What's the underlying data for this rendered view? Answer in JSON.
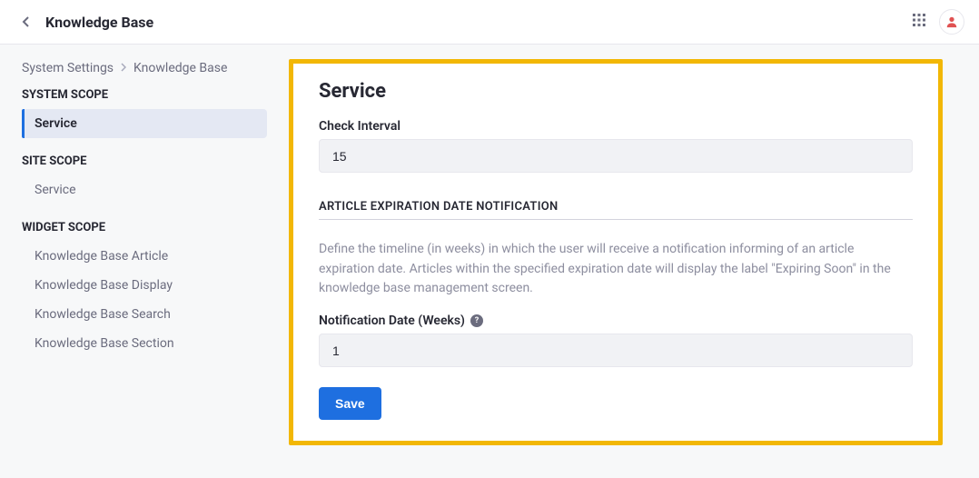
{
  "header": {
    "title": "Knowledge Base"
  },
  "breadcrumb": {
    "root": "System Settings",
    "current": "Knowledge Base"
  },
  "sidebar": {
    "scopes": [
      {
        "title": "SYSTEM SCOPE",
        "items": [
          {
            "label": "Service",
            "active": true
          }
        ]
      },
      {
        "title": "SITE SCOPE",
        "items": [
          {
            "label": "Service",
            "active": false
          }
        ]
      },
      {
        "title": "WIDGET SCOPE",
        "items": [
          {
            "label": "Knowledge Base Article",
            "active": false
          },
          {
            "label": "Knowledge Base Display",
            "active": false
          },
          {
            "label": "Knowledge Base Search",
            "active": false
          },
          {
            "label": "Knowledge Base Section",
            "active": false
          }
        ]
      }
    ]
  },
  "panel": {
    "title": "Service",
    "checkIntervalLabel": "Check Interval",
    "checkIntervalValue": "15",
    "sectionHeading": "ARTICLE EXPIRATION DATE NOTIFICATION",
    "sectionDescription": "Define the timeline (in weeks) in which the user will receive a notification informing of an article expiration date. Articles within the specified expiration date will display the label \"Expiring Soon\" in the knowledge base management screen.",
    "notificationLabel": "Notification Date (Weeks)",
    "notificationValue": "1",
    "saveLabel": "Save"
  }
}
